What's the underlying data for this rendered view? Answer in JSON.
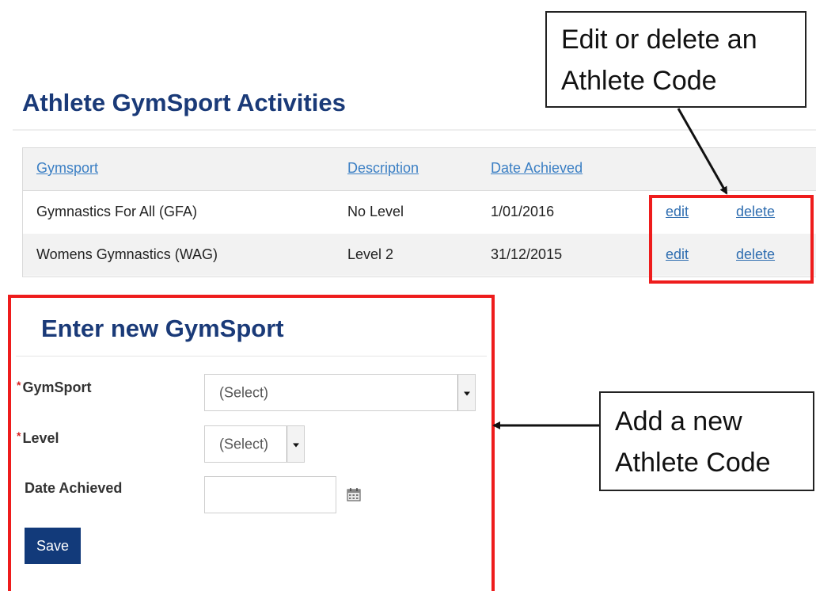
{
  "section": {
    "title": "Athlete GymSport Activities"
  },
  "table": {
    "headers": [
      "Gymsport",
      "Description",
      "Date Achieved"
    ],
    "rows": [
      {
        "gymsport": "Gymnastics For All (GFA)",
        "description": "No Level",
        "date": "1/01/2016",
        "edit": "edit",
        "delete": "delete"
      },
      {
        "gymsport": "Womens Gymnastics (WAG)",
        "description": "Level 2",
        "date": "31/12/2015",
        "edit": "edit",
        "delete": "delete"
      }
    ]
  },
  "callouts": {
    "top_line1": "Edit or delete an",
    "top_line2": "Athlete Code",
    "mid_line1": "Add a new",
    "mid_line2": "Athlete Code"
  },
  "form": {
    "title": "Enter new GymSport",
    "required_mark": "*",
    "gymsport_label": "GymSport",
    "gymsport_value": "(Select)",
    "level_label": "Level",
    "level_value": "(Select)",
    "date_label": "Date Achieved",
    "save_label": "Save"
  },
  "icons": {
    "calendar": "calendar-icon",
    "arrow": "arrow-icon",
    "dropdown": "chevron-down-icon"
  },
  "colors": {
    "title": "#1a3a78",
    "link": "#3b7fc4",
    "annotation_red": "#ee1c1c",
    "save_button": "#123a7a"
  }
}
